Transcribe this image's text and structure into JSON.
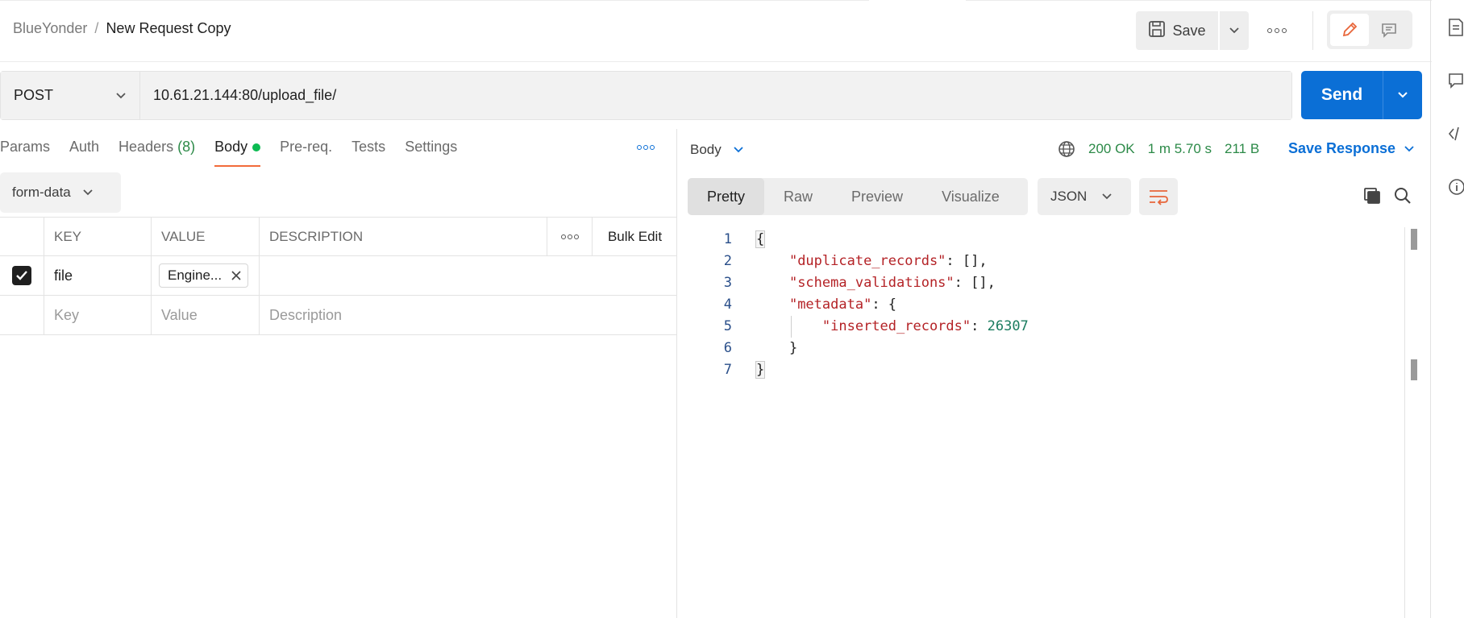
{
  "header": {
    "breadcrumb_parent": "BlueYonder",
    "breadcrumb_sep": "/",
    "title": "New Request Copy",
    "save_label": "Save"
  },
  "request": {
    "method": "POST",
    "url": "10.61.21.144:80/upload_file/",
    "send_label": "Send",
    "tabs": [
      {
        "label": "Params"
      },
      {
        "label": "Auth"
      },
      {
        "label": "Headers",
        "count": "(8)"
      },
      {
        "label": "Body"
      },
      {
        "label": "Pre-req."
      },
      {
        "label": "Tests"
      },
      {
        "label": "Settings"
      }
    ],
    "body_type": "form-data",
    "table": {
      "headers": [
        "KEY",
        "VALUE",
        "DESCRIPTION"
      ],
      "bulk_edit": "Bulk Edit",
      "rows": [
        {
          "key": "file",
          "value": "Engine...",
          "description": "",
          "checked": true
        }
      ],
      "placeholders": {
        "key": "Key",
        "value": "Value",
        "description": "Description"
      }
    }
  },
  "response": {
    "body_label": "Body",
    "status": "200 OK",
    "time": "1 m 5.70 s",
    "size": "211 B",
    "save_response": "Save Response",
    "view_tabs": [
      "Pretty",
      "Raw",
      "Preview",
      "Visualize"
    ],
    "active_view": "Pretty",
    "language": "JSON",
    "line_numbers": [
      "1",
      "2",
      "3",
      "4",
      "5",
      "6",
      "7"
    ],
    "code": {
      "l1": "{",
      "k2": "\"duplicate_records\"",
      "p2": ": [],",
      "k3": "\"schema_validations\"",
      "p3": ": [],",
      "k4": "\"metadata\"",
      "p4": ": {",
      "k5": "\"inserted_records\"",
      "p5": ": ",
      "v5": "26307",
      "l6": "}",
      "l7": "}"
    }
  },
  "colors": {
    "accent": "#0b6fd6",
    "active_tab_underline": "#f26b3a",
    "status_ok": "#2c8a48",
    "json_key": "#b42226",
    "json_number": "#1a7c5f"
  },
  "icons": [
    "save-icon",
    "chevron-down-icon",
    "more-horizontal-icon",
    "pencil-icon",
    "comment-icon",
    "globe-icon",
    "wrap-lines-icon",
    "copy-icon",
    "search-icon",
    "checkbox-checked-icon",
    "close-icon",
    "document-icon",
    "code-icon",
    "info-icon"
  ]
}
